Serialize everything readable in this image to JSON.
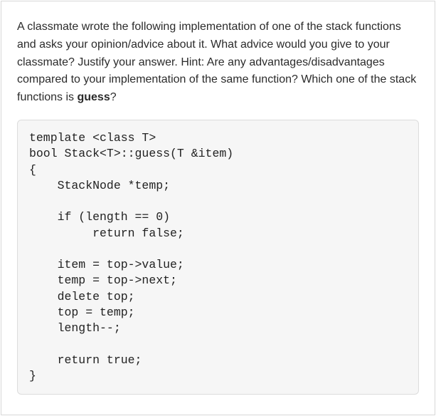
{
  "question": {
    "part1": "A classmate wrote the following implementation of one of the stack functions and asks your opinion/advice about it. What advice would you give to your classmate? Justify your answer. Hint: Are any advantages/disadvantages compared to your implementation of the same function? Which one of the stack functions is ",
    "bold": "guess",
    "part2": "?"
  },
  "code": "template <class T>\nbool Stack<T>::guess(T &item)\n{\n    StackNode *temp;\n\n    if (length == 0)\n         return false;\n\n    item = top->value;\n    temp = top->next;\n    delete top;\n    top = temp;\n    length--;\n\n    return true;\n}"
}
